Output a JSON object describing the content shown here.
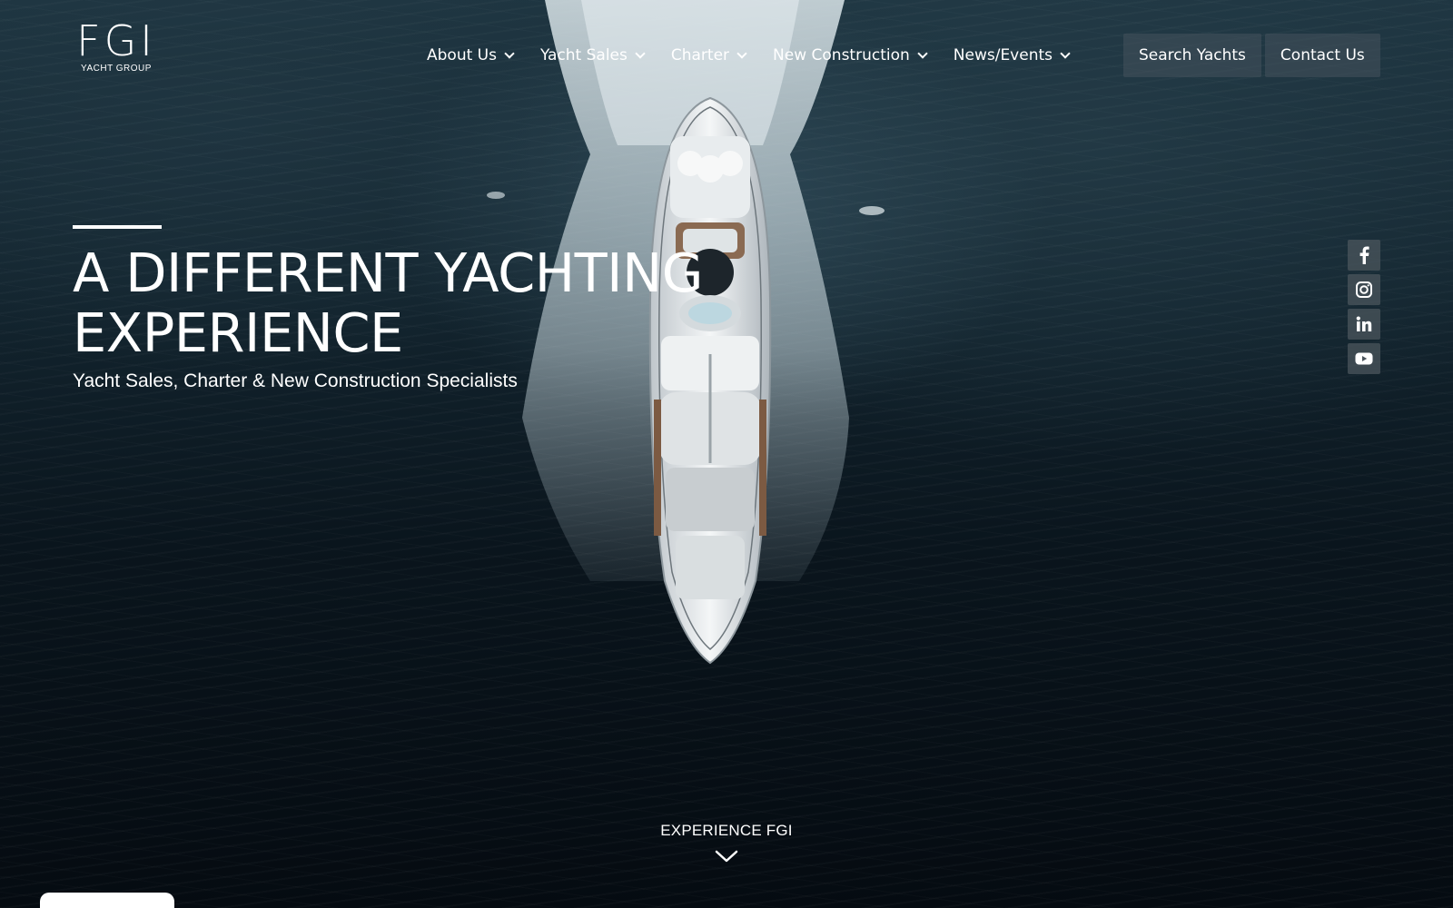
{
  "logo": {
    "mark": "FGI",
    "subtitle": "YACHT GROUP"
  },
  "nav": {
    "items": [
      {
        "label": "About Us",
        "has_dropdown": true
      },
      {
        "label": "Yacht Sales",
        "has_dropdown": true
      },
      {
        "label": "Charter",
        "has_dropdown": true
      },
      {
        "label": "New Construction",
        "has_dropdown": true
      },
      {
        "label": "News/Events",
        "has_dropdown": true
      }
    ],
    "buttons": {
      "search": "Search Yachts",
      "contact": "Contact Us"
    }
  },
  "hero": {
    "headline_line1": "A DIFFERENT YACHTING",
    "headline_line2": "EXPERIENCE",
    "subheadline": "Yacht Sales, Charter & New Construction Specialists"
  },
  "social": {
    "icons": [
      "facebook-icon",
      "instagram-icon",
      "linkedin-icon",
      "youtube-icon"
    ]
  },
  "experience": {
    "label": "EXPERIENCE FGI",
    "icon": "chevron-down-icon"
  },
  "colors": {
    "text": "#ffffff",
    "water_dark": "#050b11",
    "water_light": "#1e3541",
    "button_bg": "#46525c"
  }
}
